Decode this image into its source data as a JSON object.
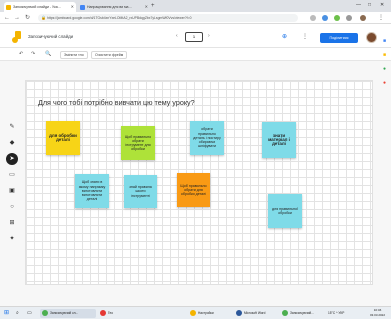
{
  "browser": {
    "tabs": [
      {
        "title": "Запозичуючий слайди - Ука…",
        "active": true
      },
      {
        "title": "Напрацювання для ви ма…",
        "active": false
      }
    ],
    "new_tab_label": "+",
    "address": "https://jamboard.google.com/d/1TGsb4xnYxeLOMtA2_rxUPBdqgZbx7yLsgmWf0Vvs/viewer?f=0",
    "window_controls": [
      "—",
      "□",
      "✕"
    ]
  },
  "app": {
    "title": "Запозичуючий слайди",
    "frame_number": "1",
    "share_label": "Поділитися",
    "more_label": "⋮"
  },
  "toolbar": {
    "undo": "↶",
    "redo": "↷",
    "zoom": "🔍",
    "background_label": "Змінити тло",
    "clear_label": "Очистити фрейм"
  },
  "canvas": {
    "question": "Для чого тобі потрібно вивчати цю тему уроку?",
    "notes": [
      {
        "text": "для обробки деталі",
        "color": "#f7d417"
      },
      {
        "text": "Щоб правильно обрати інструмент для обробки",
        "color": "#aee239"
      },
      {
        "text": "обрати правильно деталь і постиру обираючи шліфувати",
        "color": "#7fdbe8"
      },
      {
        "text": "знати матеріал і деталі",
        "color": "#7fdbe8"
      },
      {
        "text": "Щоб знати в якому напрямку виготовляти виготовляти деталі",
        "color": "#7fdbe8"
      },
      {
        "text": "знай правила шкоти інструменті",
        "color": "#7fdbe8"
      },
      {
        "text": "Щоб правильно обрати для обробки деталі",
        "color": "#f99a14"
      },
      {
        "text": "для правильної обробки",
        "color": "#7fdbe8"
      }
    ]
  },
  "taskbar": {
    "items": [
      "Запозичуючий сл...",
      "Гео",
      "Настройки",
      "Microsoft Word",
      "Запозичуючий..."
    ],
    "tray": "15°C  ^  УКР",
    "time": "10:46",
    "date": "03.03.2022"
  }
}
